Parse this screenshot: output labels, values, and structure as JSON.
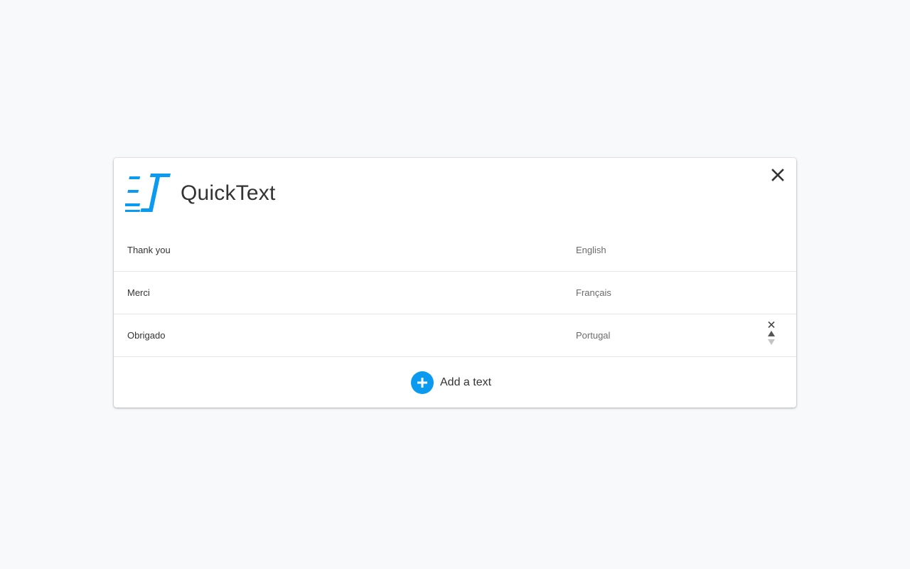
{
  "app": {
    "title": "QuickText",
    "brand_color": "#0a9af0"
  },
  "header": {
    "logo_icon": "quicktext-logo-icon",
    "close_icon": "close-icon"
  },
  "texts": [
    {
      "text": "Thank you",
      "language": "English"
    },
    {
      "text": "Merci",
      "language": "Français"
    },
    {
      "text": "Obrigado",
      "language": "Portugal"
    }
  ],
  "row_controls": {
    "delete_icon": "delete-icon",
    "move_up_icon": "move-up-icon",
    "move_down_icon": "move-down-icon"
  },
  "footer": {
    "add_label": "Add a text",
    "add_icon": "plus-circle-icon"
  }
}
